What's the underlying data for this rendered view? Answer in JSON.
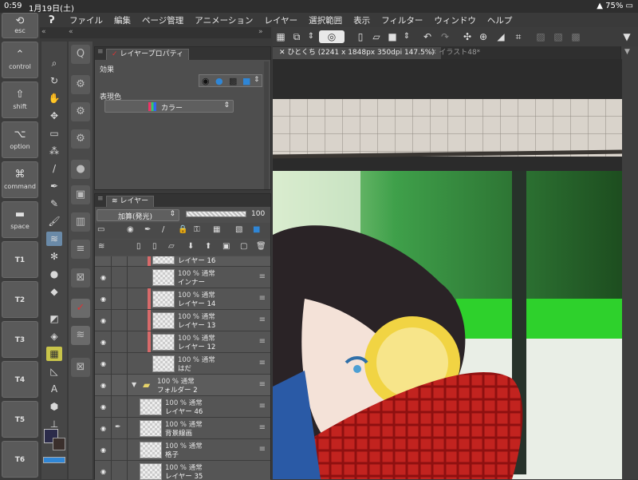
{
  "status": {
    "time": "0:59",
    "date": "1月19日(土)",
    "battery": "75%"
  },
  "menu": {
    "items": [
      "ファイル",
      "編集",
      "ページ管理",
      "アニメーション",
      "レイヤー",
      "選択範囲",
      "表示",
      "フィルター",
      "ウィンドウ",
      "ヘルプ"
    ]
  },
  "keys": {
    "esc": "esc",
    "control": "control",
    "shift": "shift",
    "option": "option",
    "command": "command",
    "space": "space",
    "t1": "T1",
    "t2": "T2",
    "t3": "T3",
    "t4": "T4",
    "t5": "T5",
    "t6": "T6"
  },
  "props_panel": {
    "tab": "レイヤープロパティ",
    "effect_label": "効果",
    "expression_label": "表現色",
    "expression_value": "カラー"
  },
  "layers_panel": {
    "tab": "レイヤー",
    "blend_mode": "加算(発光)",
    "opacity": "100",
    "rows": [
      {
        "mode": "",
        "name": "レイヤー 16"
      },
      {
        "mode": "100 % 通常",
        "name": "インナー"
      },
      {
        "mode": "100 % 通常",
        "name": "レイヤー 14"
      },
      {
        "mode": "100 % 通常",
        "name": "レイヤー 13"
      },
      {
        "mode": "100 % 通常",
        "name": "レイヤー 12"
      },
      {
        "mode": "100 % 通常",
        "name": "はだ"
      },
      {
        "mode": "100 % 通常",
        "name": "フォルダー 2"
      },
      {
        "mode": "100 % 通常",
        "name": "レイヤー 46"
      },
      {
        "mode": "100 % 通常",
        "name": "背景線画"
      },
      {
        "mode": "100 % 通常",
        "name": "格子"
      },
      {
        "mode": "100 % 通常",
        "name": "レイヤー 35"
      }
    ]
  },
  "canvas": {
    "tab_active": "ひとくち (2241 x 1848px 350dpi 147.5%)",
    "tab_other": "イラスト48*"
  },
  "colors": {
    "layer_marker": "#d86a6a",
    "accent_blue": "#2f86d6",
    "main_color": "#2b2b4a"
  }
}
